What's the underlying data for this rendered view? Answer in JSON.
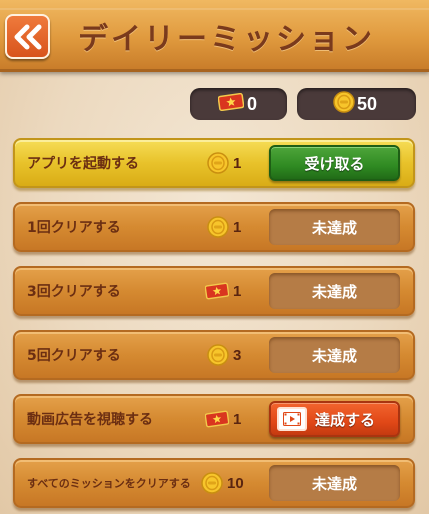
{
  "header": {
    "title": "デイリーミッション",
    "back_icon": "double-chevron-left-icon"
  },
  "wallet": {
    "tickets": "0",
    "coins": "50"
  },
  "colors": {
    "header": "#e09a3e",
    "title": "#7a3a1c",
    "row": "#d58a31",
    "row_done": "#e8c22a",
    "claim_button": "#2f8a22",
    "ad_button": "#e14817",
    "pending_button": "#b57c46"
  },
  "missions": [
    {
      "label": "アプリを起動する",
      "reward_icon": "coin-icon",
      "reward": "1",
      "button": "受け取る",
      "state": "claimable"
    },
    {
      "label": "1回クリアする",
      "reward_icon": "coin-icon",
      "reward": "1",
      "button": "未達成",
      "state": "incomplete"
    },
    {
      "label": "3回クリアする",
      "reward_icon": "ticket-icon",
      "reward": "1",
      "button": "未達成",
      "state": "incomplete"
    },
    {
      "label": "5回クリアする",
      "reward_icon": "coin-icon",
      "reward": "3",
      "button": "未達成",
      "state": "incomplete"
    },
    {
      "label": "動画広告を視聴する",
      "reward_icon": "ticket-icon",
      "reward": "1",
      "button": "達成する",
      "state": "watch-ad"
    },
    {
      "label": "すべてのミッションをクリアする",
      "reward_icon": "coin-icon",
      "reward": "10",
      "button": "未達成",
      "state": "incomplete"
    }
  ]
}
